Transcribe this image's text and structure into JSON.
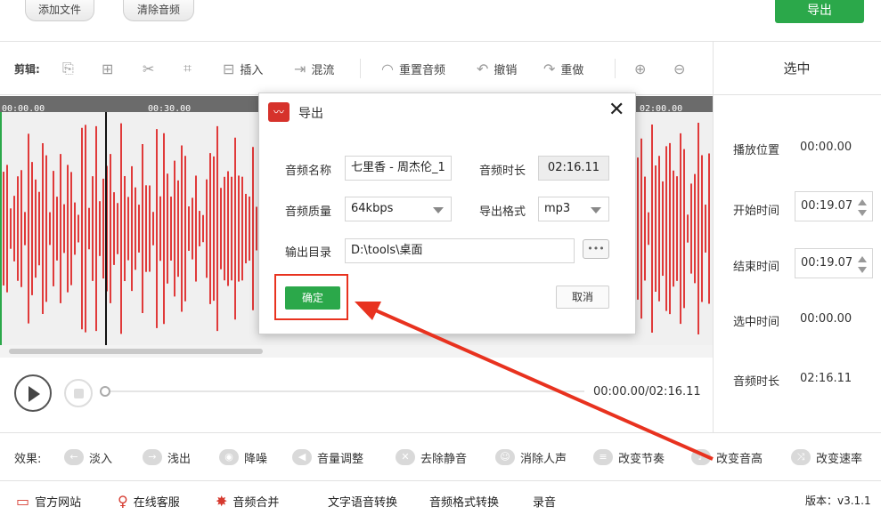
{
  "top": {
    "add_file": "添加文件",
    "clear_audio": "清除音频",
    "export": "导出"
  },
  "toolbar": {
    "label": "剪辑:",
    "insert": "插入",
    "mix": "混流",
    "reset_audio": "重置音频",
    "undo": "撤销",
    "redo": "重做"
  },
  "side": {
    "header": "选中",
    "play_pos_label": "播放位置",
    "play_pos": "00:00.00",
    "start_label": "开始时间",
    "start": "00:19.07",
    "end_label": "结束时间",
    "end": "00:19.07",
    "selected_label": "选中时间",
    "selected": "00:00.00",
    "duration_label": "音频时长",
    "duration": "02:16.11"
  },
  "timeline": {
    "ticks": [
      "00:00.00",
      "00:30.00",
      "02:00.00"
    ]
  },
  "player": {
    "time": "00:00.00/02:16.11"
  },
  "effects": {
    "label": "效果:",
    "fade_in": "淡入",
    "fade_out": "浅出",
    "denoise": "降噪",
    "volume": "音量调整",
    "remove_silence": "去除静音",
    "remove_vocal": "消除人声",
    "tempo": "改变节奏",
    "pitch": "改变音高",
    "speed": "改变速率"
  },
  "bottom": {
    "site": "官方网站",
    "support": "在线客服",
    "merge": "音频合并",
    "tts": "文字语音转换",
    "format": "音频格式转换",
    "record": "录音",
    "version": "版本：v3.1.1"
  },
  "dialog": {
    "title": "导出",
    "name_label": "音频名称",
    "name_value": "七里香 - 周杰伦_1",
    "duration_label": "音频时长",
    "duration_value": "02:16.11",
    "quality_label": "音频质量",
    "quality_value": "64kbps",
    "format_label": "导出格式",
    "format_value": "mp3",
    "dir_label": "输出目录",
    "dir_value": "D:\\tools\\桌面",
    "browse": "•••",
    "ok": "确定",
    "cancel": "取消"
  },
  "colors": {
    "accent": "#2ba84a",
    "wave": "#e03a3a",
    "annotation": "#e8321f"
  }
}
